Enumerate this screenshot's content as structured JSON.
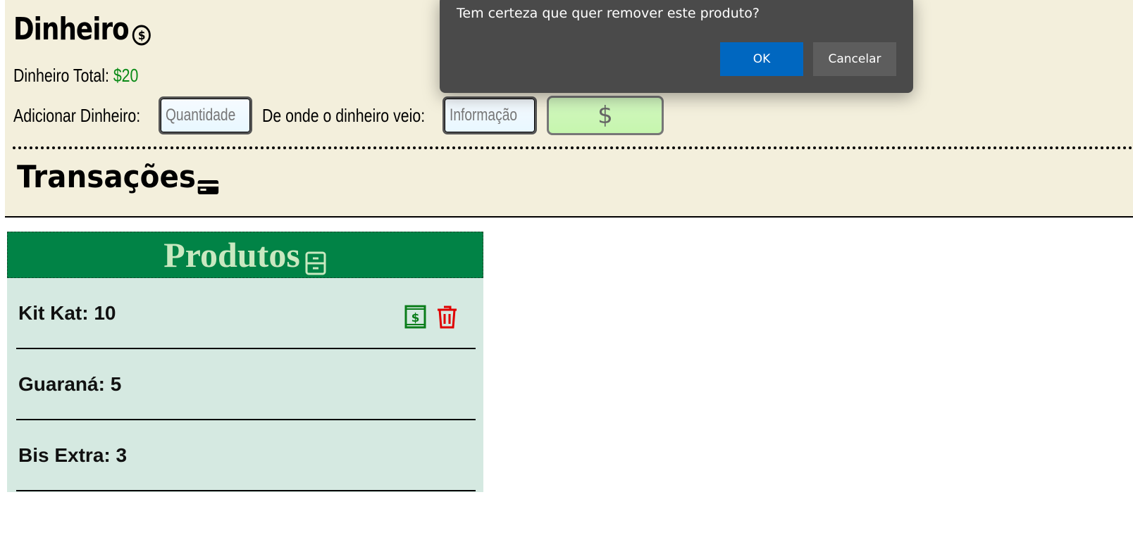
{
  "money": {
    "title": "Dinheiro",
    "total_label": "Dinheiro Total: ",
    "total_value": "$20",
    "add_label": "Adicionar Dinheiro:",
    "quantity_placeholder": "Quantidade",
    "source_label": "De onde o dinheiro veio:",
    "source_placeholder": "Informação",
    "add_button_symbol": "$",
    "title_icon": "dollar-coin-icon"
  },
  "transactions": {
    "title": "Transações",
    "title_icon": "credit-card-icon"
  },
  "products": {
    "title": "Produtos",
    "title_icon": "archive-box-icon",
    "items": [
      {
        "label": "Kit Kat: 10",
        "show_actions": true
      },
      {
        "label": "Guaraná: 5",
        "show_actions": false
      },
      {
        "label": "Bis Extra: 3",
        "show_actions": false
      }
    ],
    "action_icons": [
      "money-bill-icon",
      "trash-icon"
    ]
  },
  "dialog": {
    "message": "Tem certeza que quer remover este produto?",
    "ok_label": "OK",
    "cancel_label": "Cancelar"
  },
  "colors": {
    "panel_bg": "#f3efdc",
    "money_green": "#098a16",
    "products_header": "#018346",
    "products_bg": "#d5e9e1",
    "trash_red": "#e00000",
    "dialog_bg": "#4a4a4a",
    "ok_blue": "#0067c0"
  }
}
